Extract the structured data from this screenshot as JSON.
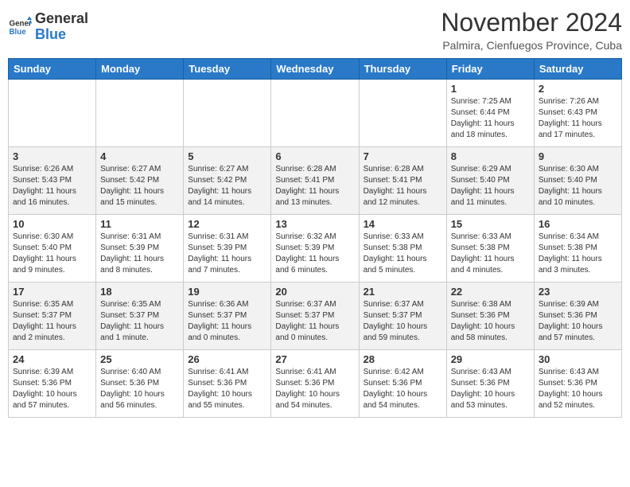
{
  "logo": {
    "general": "General",
    "blue": "Blue"
  },
  "header": {
    "month": "November 2024",
    "location": "Palmira, Cienfuegos Province, Cuba"
  },
  "weekdays": [
    "Sunday",
    "Monday",
    "Tuesday",
    "Wednesday",
    "Thursday",
    "Friday",
    "Saturday"
  ],
  "weeks": [
    [
      {
        "day": "",
        "info": ""
      },
      {
        "day": "",
        "info": ""
      },
      {
        "day": "",
        "info": ""
      },
      {
        "day": "",
        "info": ""
      },
      {
        "day": "",
        "info": ""
      },
      {
        "day": "1",
        "info": "Sunrise: 7:25 AM\nSunset: 6:44 PM\nDaylight: 11 hours and 18 minutes."
      },
      {
        "day": "2",
        "info": "Sunrise: 7:26 AM\nSunset: 6:43 PM\nDaylight: 11 hours and 17 minutes."
      }
    ],
    [
      {
        "day": "3",
        "info": "Sunrise: 6:26 AM\nSunset: 5:43 PM\nDaylight: 11 hours and 16 minutes."
      },
      {
        "day": "4",
        "info": "Sunrise: 6:27 AM\nSunset: 5:42 PM\nDaylight: 11 hours and 15 minutes."
      },
      {
        "day": "5",
        "info": "Sunrise: 6:27 AM\nSunset: 5:42 PM\nDaylight: 11 hours and 14 minutes."
      },
      {
        "day": "6",
        "info": "Sunrise: 6:28 AM\nSunset: 5:41 PM\nDaylight: 11 hours and 13 minutes."
      },
      {
        "day": "7",
        "info": "Sunrise: 6:28 AM\nSunset: 5:41 PM\nDaylight: 11 hours and 12 minutes."
      },
      {
        "day": "8",
        "info": "Sunrise: 6:29 AM\nSunset: 5:40 PM\nDaylight: 11 hours and 11 minutes."
      },
      {
        "day": "9",
        "info": "Sunrise: 6:30 AM\nSunset: 5:40 PM\nDaylight: 11 hours and 10 minutes."
      }
    ],
    [
      {
        "day": "10",
        "info": "Sunrise: 6:30 AM\nSunset: 5:40 PM\nDaylight: 11 hours and 9 minutes."
      },
      {
        "day": "11",
        "info": "Sunrise: 6:31 AM\nSunset: 5:39 PM\nDaylight: 11 hours and 8 minutes."
      },
      {
        "day": "12",
        "info": "Sunrise: 6:31 AM\nSunset: 5:39 PM\nDaylight: 11 hours and 7 minutes."
      },
      {
        "day": "13",
        "info": "Sunrise: 6:32 AM\nSunset: 5:39 PM\nDaylight: 11 hours and 6 minutes."
      },
      {
        "day": "14",
        "info": "Sunrise: 6:33 AM\nSunset: 5:38 PM\nDaylight: 11 hours and 5 minutes."
      },
      {
        "day": "15",
        "info": "Sunrise: 6:33 AM\nSunset: 5:38 PM\nDaylight: 11 hours and 4 minutes."
      },
      {
        "day": "16",
        "info": "Sunrise: 6:34 AM\nSunset: 5:38 PM\nDaylight: 11 hours and 3 minutes."
      }
    ],
    [
      {
        "day": "17",
        "info": "Sunrise: 6:35 AM\nSunset: 5:37 PM\nDaylight: 11 hours and 2 minutes."
      },
      {
        "day": "18",
        "info": "Sunrise: 6:35 AM\nSunset: 5:37 PM\nDaylight: 11 hours and 1 minute."
      },
      {
        "day": "19",
        "info": "Sunrise: 6:36 AM\nSunset: 5:37 PM\nDaylight: 11 hours and 0 minutes."
      },
      {
        "day": "20",
        "info": "Sunrise: 6:37 AM\nSunset: 5:37 PM\nDaylight: 11 hours and 0 minutes."
      },
      {
        "day": "21",
        "info": "Sunrise: 6:37 AM\nSunset: 5:37 PM\nDaylight: 10 hours and 59 minutes."
      },
      {
        "day": "22",
        "info": "Sunrise: 6:38 AM\nSunset: 5:36 PM\nDaylight: 10 hours and 58 minutes."
      },
      {
        "day": "23",
        "info": "Sunrise: 6:39 AM\nSunset: 5:36 PM\nDaylight: 10 hours and 57 minutes."
      }
    ],
    [
      {
        "day": "24",
        "info": "Sunrise: 6:39 AM\nSunset: 5:36 PM\nDaylight: 10 hours and 57 minutes."
      },
      {
        "day": "25",
        "info": "Sunrise: 6:40 AM\nSunset: 5:36 PM\nDaylight: 10 hours and 56 minutes."
      },
      {
        "day": "26",
        "info": "Sunrise: 6:41 AM\nSunset: 5:36 PM\nDaylight: 10 hours and 55 minutes."
      },
      {
        "day": "27",
        "info": "Sunrise: 6:41 AM\nSunset: 5:36 PM\nDaylight: 10 hours and 54 minutes."
      },
      {
        "day": "28",
        "info": "Sunrise: 6:42 AM\nSunset: 5:36 PM\nDaylight: 10 hours and 54 minutes."
      },
      {
        "day": "29",
        "info": "Sunrise: 6:43 AM\nSunset: 5:36 PM\nDaylight: 10 hours and 53 minutes."
      },
      {
        "day": "30",
        "info": "Sunrise: 6:43 AM\nSunset: 5:36 PM\nDaylight: 10 hours and 52 minutes."
      }
    ]
  ]
}
